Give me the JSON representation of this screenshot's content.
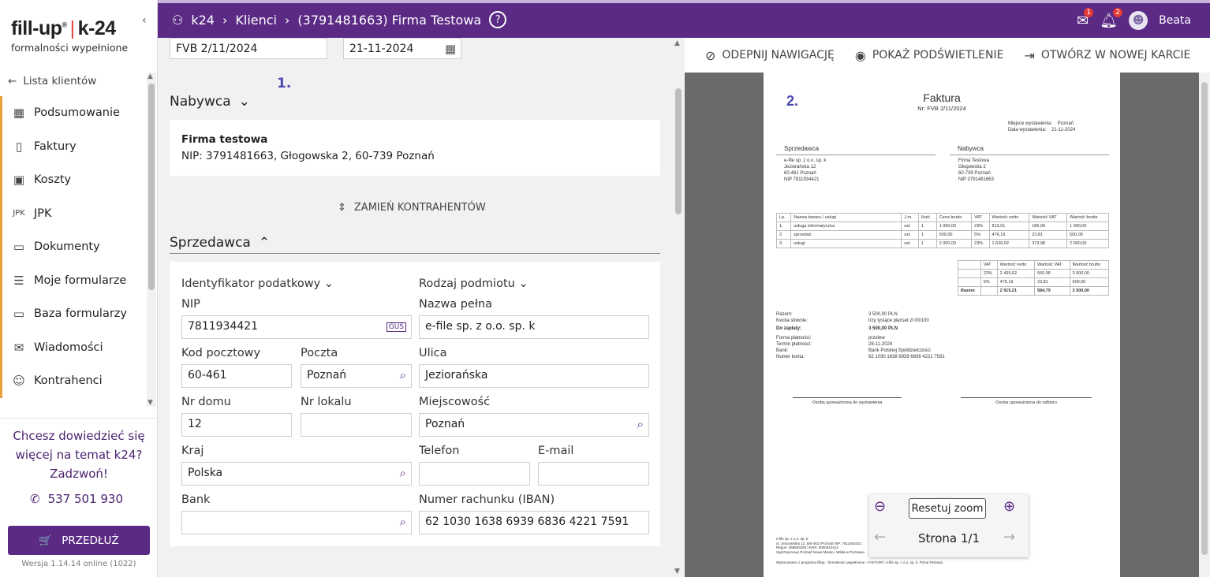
{
  "brand": {
    "logo_a": "fill-up",
    "logo_reg": "®",
    "logo_b": "k-24",
    "logo_sub": "formalności wypełnione"
  },
  "sidebar": {
    "back_label": "Lista klientów",
    "items": [
      {
        "label": "Podsumowanie",
        "icon": "calculator-icon"
      },
      {
        "label": "Faktury",
        "icon": "invoice-icon"
      },
      {
        "label": "Koszty",
        "icon": "costs-icon"
      },
      {
        "label": "JPK",
        "icon": "jpk-icon"
      },
      {
        "label": "Dokumenty",
        "icon": "folder-icon"
      },
      {
        "label": "Moje formularze",
        "icon": "form-icon"
      },
      {
        "label": "Baza formularzy",
        "icon": "folders-icon"
      },
      {
        "label": "Wiadomości",
        "icon": "mail-icon"
      },
      {
        "label": "Kontrahenci",
        "icon": "person-icon"
      }
    ],
    "promo_line1": "Chcesz dowiedzieć się",
    "promo_line2": "więcej na temat k24?",
    "promo_line3": "Zadzwoń!",
    "phone": "537 501 930",
    "extend_label": "PRZEDŁUŻ",
    "version": "Wersja 1.14.14 online (1022)"
  },
  "header": {
    "crumb1": "k24",
    "crumb2": "Klienci",
    "crumb3": "(3791481663) Firma Testowa",
    "help": "?",
    "mail_badge": "1",
    "bell_badge": "2",
    "user": "Beata"
  },
  "form": {
    "invoice_number": "FVB 2/11/2024",
    "invoice_date": "21-11-2024",
    "marker1": "1.",
    "buyer_title": "Nabywca",
    "buyer_name": "Firma testowa",
    "buyer_details": "NIP: 3791481663,  Głogowska 2, 60-739 Poznań",
    "swap_label": "ZAMIEŃ KONTRAHENTÓW",
    "seller_title": "Sprzedawca",
    "tax_id_label": "Identyfikator podatkowy",
    "entity_type_label": "Rodzaj podmiotu",
    "nip_label": "NIP",
    "nip_value": "7811934421",
    "gus": "GUS",
    "fullname_label": "Nazwa pełna",
    "fullname_value": "e-file sp. z o.o. sp. k",
    "postcode_label": "Kod pocztowy",
    "postcode_value": "60-461",
    "post_label": "Poczta",
    "post_value": "Poznań",
    "street_label": "Ulica",
    "street_value": "Jeziorańska",
    "house_label": "Nr domu",
    "house_value": "12",
    "apt_label": "Nr lokalu",
    "apt_value": "",
    "city_label": "Miejscowość",
    "city_value": "Poznań",
    "country_label": "Kraj",
    "country_value": "Polska",
    "phone_label": "Telefon",
    "phone_value": "",
    "email_label": "E-mail",
    "email_value": "",
    "bank_label": "Bank",
    "bank_value": "",
    "iban_label": "Numer rachunku (IBAN)",
    "iban_value": "62 1030 1638 6939 6836 4221 7591"
  },
  "preview": {
    "unpin": "ODEPNIJ NAWIGACJĘ",
    "highlight": "POKAŻ PODŚWIETLENIE",
    "newtab": "OTWÓRZ W NOWEJ KARCIE",
    "marker2": "2.",
    "doc_title": "Faktura",
    "doc_nr": "Nr: FVB 2/11/2024",
    "place_label": "Miejsce wystawienia:",
    "place_value": "Poznań",
    "date_label": "Data wystawienia:",
    "date_value": "21-11-2024",
    "seller_h": "Sprzedawca",
    "seller_l1": "e-file sp. z o.o. sp. k",
    "seller_l2": "Jeziorańska 12",
    "seller_l3": "60-461 Poznań",
    "seller_l4": "NIP 7811934421",
    "buyer_h": "Nabywca",
    "buyer_l1": "Firma Testowa",
    "buyer_l2": "Głogowska 2",
    "buyer_l3": "60-739 Poznań",
    "buyer_l4": "NIP 3791481663",
    "items_header": [
      "Lp.",
      "Nazwa towaru / usługi",
      "J.m.",
      "Ilość",
      "Cena brutto",
      "VAT",
      "Wartość netto",
      "Wartość VAT",
      "Wartość brutto"
    ],
    "items": [
      [
        "1.",
        "usługa informatyczna",
        "szt.",
        "1",
        "1 000,00",
        "23%",
        "813,01",
        "186,99",
        "1 000,00"
      ],
      [
        "2.",
        "sprzedaż",
        "szt.",
        "1",
        "500,00",
        "5%",
        "476,19",
        "23,81",
        "500,00"
      ],
      [
        "3.",
        "usługi",
        "szt.",
        "1",
        "2 000,00",
        "23%",
        "1 626,02",
        "373,98",
        "2 000,00"
      ]
    ],
    "vat_header": [
      "",
      "VAT",
      "Wartość netto",
      "Wartość VAT",
      "Wartość brutto"
    ],
    "vat_rows": [
      [
        "",
        "23%",
        "2 439,02",
        "560,98",
        "3 000,00"
      ],
      [
        "",
        "5%",
        "476,19",
        "23,81",
        "500,00"
      ],
      [
        "Razem",
        "",
        "2 915,21",
        "584,79",
        "3 500,00"
      ]
    ],
    "sum_labels": [
      "Razem:",
      "Kwota słownie:",
      "Do zapłaty:",
      "Forma płatności:",
      "Termin płatności:",
      "Bank:",
      "Numer konta:"
    ],
    "sum_values": [
      "3 500,00 PLN",
      "trzy  tysiące  pięćset  zł 00/100",
      "3 500,00 PLN",
      "przelew",
      "28-11-2024",
      "Bank Polskiej Spółdzielczości",
      "62 1030 1638 6939 6836 4221 7591"
    ],
    "sign1": "Osoba upoważniona do wystawienia",
    "sign2": "Osoba upoważniona do odbioru",
    "footer1": "e-file sp. z o.o. sp. k.",
    "footer2": "ul. Jeziorańska 12, (60-461) Poznań NIP: 7811934421",
    "footer3": "Regon: 368593283 | KRS: 0000642414",
    "footer4": "Sąd Rejonowy Poznań Nowe Miasto i Wilda w Poznaniu",
    "footer5": "Wykonowano z programu fillup - formalności wypełnione - FAKTURY: e-file sp. z o.o. sp. k. Firma Testowa",
    "zoom_reset": "Resetuj zoom",
    "page": "Strona 1/1"
  }
}
